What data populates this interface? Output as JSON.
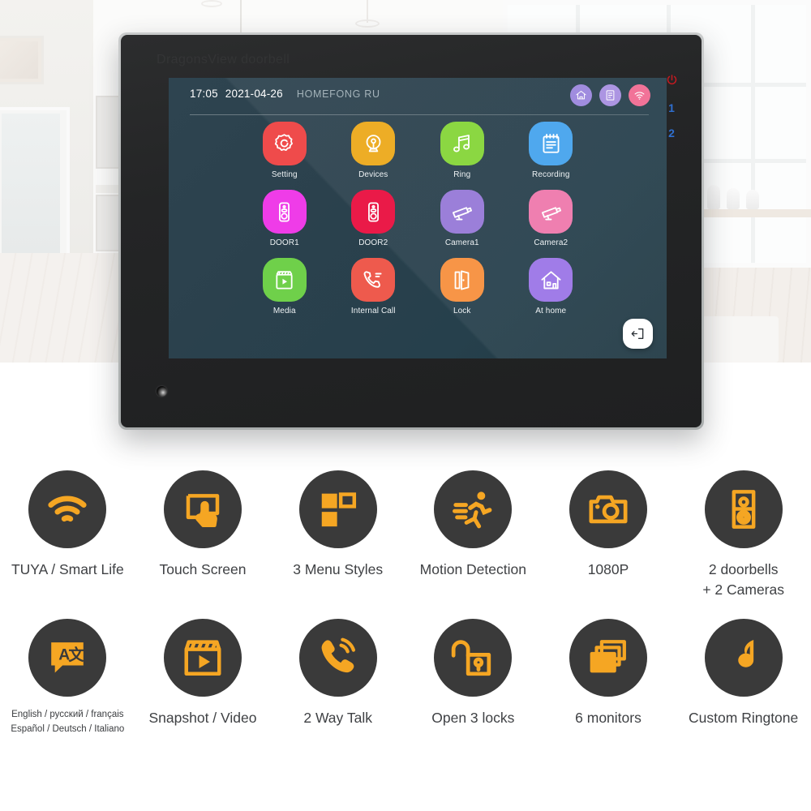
{
  "device": {
    "brand_watermark": "DragonsView doorbell",
    "side_keys": [
      {
        "name": "power",
        "label": "⏻",
        "color": "#c51a20"
      },
      {
        "name": "monitor-1",
        "label": "1",
        "color": "#2f6fd0"
      },
      {
        "name": "monitor-2",
        "label": "2",
        "color": "#2f6fd0"
      }
    ]
  },
  "screen": {
    "statusbar": {
      "time": "17:05",
      "date": "2021-04-26",
      "owner": "HOMEFONG RU",
      "icons": [
        {
          "name": "home-icon",
          "color": "#9b86dd"
        },
        {
          "name": "document-icon",
          "color": "#a78fe0"
        },
        {
          "name": "wifi-icon",
          "color": "#f06b92"
        }
      ]
    },
    "apps": [
      {
        "label": "Setting",
        "icon": "gear-icon",
        "color": "#ef4b4b"
      },
      {
        "label": "Devices",
        "icon": "webcam-icon",
        "color": "#edad26"
      },
      {
        "label": "Ring",
        "icon": "music-note-icon",
        "color": "#8bd742"
      },
      {
        "label": "Recording",
        "icon": "clipboard-icon",
        "color": "#4fa8ee"
      },
      {
        "label": "DOOR1",
        "icon": "doorbell-icon",
        "color": "#ef3ce8"
      },
      {
        "label": "DOOR2",
        "icon": "doorbell-icon",
        "color": "#ea1a48"
      },
      {
        "label": "Camera1",
        "icon": "cctv-icon",
        "color": "#9b7fd9"
      },
      {
        "label": "Camera2",
        "icon": "cctv-icon",
        "color": "#ef7fb0"
      },
      {
        "label": "Media",
        "icon": "clapper-icon",
        "color": "#6fd04a"
      },
      {
        "label": "Internal Call",
        "icon": "phone-call-icon",
        "color": "#ee5a4d"
      },
      {
        "label": "Lock",
        "icon": "door-open-icon",
        "color": "#f79547"
      },
      {
        "label": "At home",
        "icon": "house-icon",
        "color": "#a07ce8"
      }
    ],
    "exit_button": {
      "name": "exit-icon",
      "label": "Exit"
    }
  },
  "features": [
    {
      "label": "TUYA / Smart Life",
      "icon": "wifi-icon",
      "small": false
    },
    {
      "label": "Touch Screen",
      "icon": "touch-icon",
      "small": false
    },
    {
      "label": "3 Menu Styles",
      "icon": "layout-icon",
      "small": false
    },
    {
      "label": "Motion Detection",
      "icon": "running-icon",
      "small": false
    },
    {
      "label": "1080P",
      "icon": "camera-icon",
      "small": false
    },
    {
      "label": "2 doorbells\n+ 2 Cameras",
      "icon": "doorbell-icon",
      "small": false
    },
    {
      "label": "English / русский / français\nEspañol /  Deutsch / Italiano",
      "icon": "translate-icon",
      "small": true
    },
    {
      "label": "Snapshot / Video",
      "icon": "clapper-icon",
      "small": false
    },
    {
      "label": "2 Way Talk",
      "icon": "phone-call-icon",
      "small": false
    },
    {
      "label": "Open 3 locks",
      "icon": "unlock-icon",
      "small": false
    },
    {
      "label": "6 monitors",
      "icon": "monitors-icon",
      "small": false
    },
    {
      "label": "Custom Ringtone",
      "icon": "music-note-icon",
      "small": false
    }
  ],
  "colors": {
    "accent_orange": "#f5a623",
    "feature_circle": "#3a3a3a",
    "screen_bg": "#2a404c",
    "bezel": "#242526"
  }
}
